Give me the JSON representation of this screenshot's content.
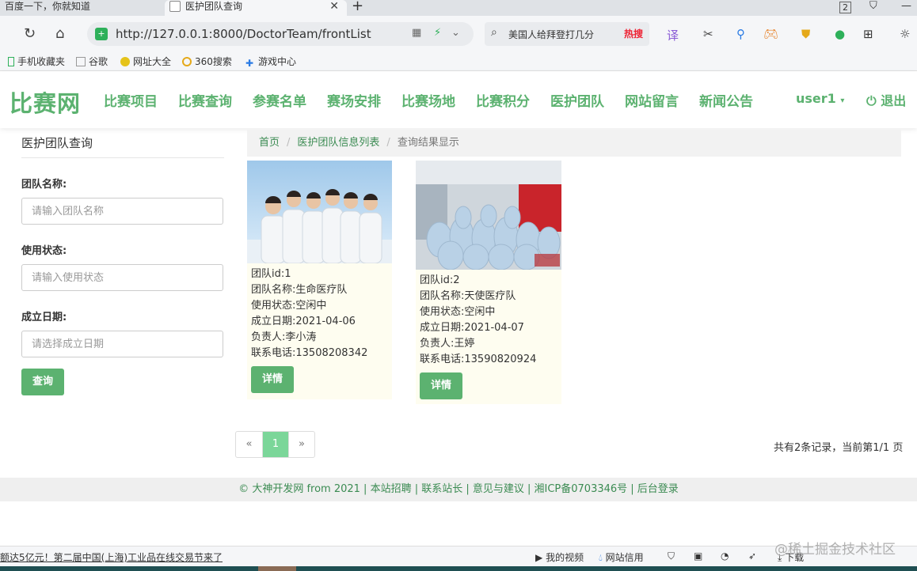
{
  "browser": {
    "tab_inactive": "百度一下，你就知道",
    "tab_active": "医护团队查询",
    "tab_count": "2",
    "url": "http://127.0.0.1:8000/DoctorTeam/frontList",
    "search_text": "美国人给拜登打几分",
    "search_hot": "热搜",
    "bookmarks": [
      "手机收藏夹",
      "谷歌",
      "网址大全",
      "360搜索",
      "游戏中心"
    ]
  },
  "site": {
    "logo": "比赛网",
    "nav": [
      "比赛项目",
      "比赛查询",
      "参赛名单",
      "赛场安排",
      "比赛场地",
      "比赛积分",
      "医护团队",
      "网站留言",
      "新闻公告"
    ],
    "user": "user1",
    "logout": "退出"
  },
  "sidebar": {
    "title": "医护团队查询",
    "fields": [
      {
        "label": "团队名称:",
        "placeholder": "请输入团队名称"
      },
      {
        "label": "使用状态:",
        "placeholder": "请输入使用状态"
      },
      {
        "label": "成立日期:",
        "placeholder": "请选择成立日期"
      }
    ],
    "query_button": "查询"
  },
  "breadcrumb": {
    "home": "首页",
    "list": "医护团队信息列表",
    "current": "查询结果显示"
  },
  "cards": [
    {
      "id": "团队id:1",
      "name": "团队名称:生命医疗队",
      "status": "使用状态:空闲中",
      "date": "成立日期:2021-04-06",
      "leader": "负责人:李小涛",
      "phone": "联系电话:13508208342",
      "button": "详情"
    },
    {
      "id": "团队id:2",
      "name": "团队名称:天使医疗队",
      "status": "使用状态:空闲中",
      "date": "成立日期:2021-04-07",
      "leader": "负责人:王婷",
      "phone": "联系电话:13590820924",
      "button": "详情"
    }
  ],
  "pagination": {
    "prev": "«",
    "current": "1",
    "next": "»",
    "info": "共有2条记录，当前第1/1 页"
  },
  "footer": "© 大神开发网 from 2021 | 本站招聘 | 联系站长 | 意见与建议 | 湘ICP备0703346号 | 后台登录",
  "statusbar": {
    "news": "额达5亿元！第二届中国(上海)工业品在线交易节来了",
    "my_video": "我的视频",
    "site_credit": "网站信用",
    "download": "下载"
  },
  "watermark": "@稀土掘金技术社区",
  "colors": {
    "accent": "#5cb270",
    "pager_active": "#7bd699"
  }
}
